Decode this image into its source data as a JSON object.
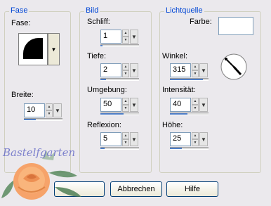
{
  "fase": {
    "title": "Fase",
    "fase_label": "Fase:",
    "breite_label": "Breite:",
    "breite_value": "10"
  },
  "bild": {
    "title": "Bild",
    "schliff_label": "Schliff:",
    "schliff_value": "1",
    "tiefe_label": "Tiefe:",
    "tiefe_value": "2",
    "umgebung_label": "Umgebung:",
    "umgebung_value": "50",
    "reflexion_label": "Reflexion:",
    "reflexion_value": "5"
  },
  "licht": {
    "title": "Lichtquelle",
    "farbe_label": "Farbe:",
    "winkel_label": "Winkel:",
    "winkel_value": "315",
    "intensitaet_label": "Intensität:",
    "intensitaet_value": "40",
    "hoehe_label": "Höhe:",
    "hoehe_value": "25"
  },
  "buttons": {
    "abbrechen": "Abbrechen",
    "hilfe": "Hilfe"
  },
  "watermark": "Bastelfgarten",
  "colors": {
    "accent": "#0046d5",
    "slider_fill": "#4f7ec7",
    "background": "#ebe9ed"
  },
  "sliders": {
    "breite": 0.3,
    "schliff": 0.05,
    "tiefe": 0.15,
    "umgebung": 0.6,
    "reflexion": 0.1,
    "winkel": 0.85,
    "intensitaet": 0.45,
    "hoehe": 0.3
  }
}
